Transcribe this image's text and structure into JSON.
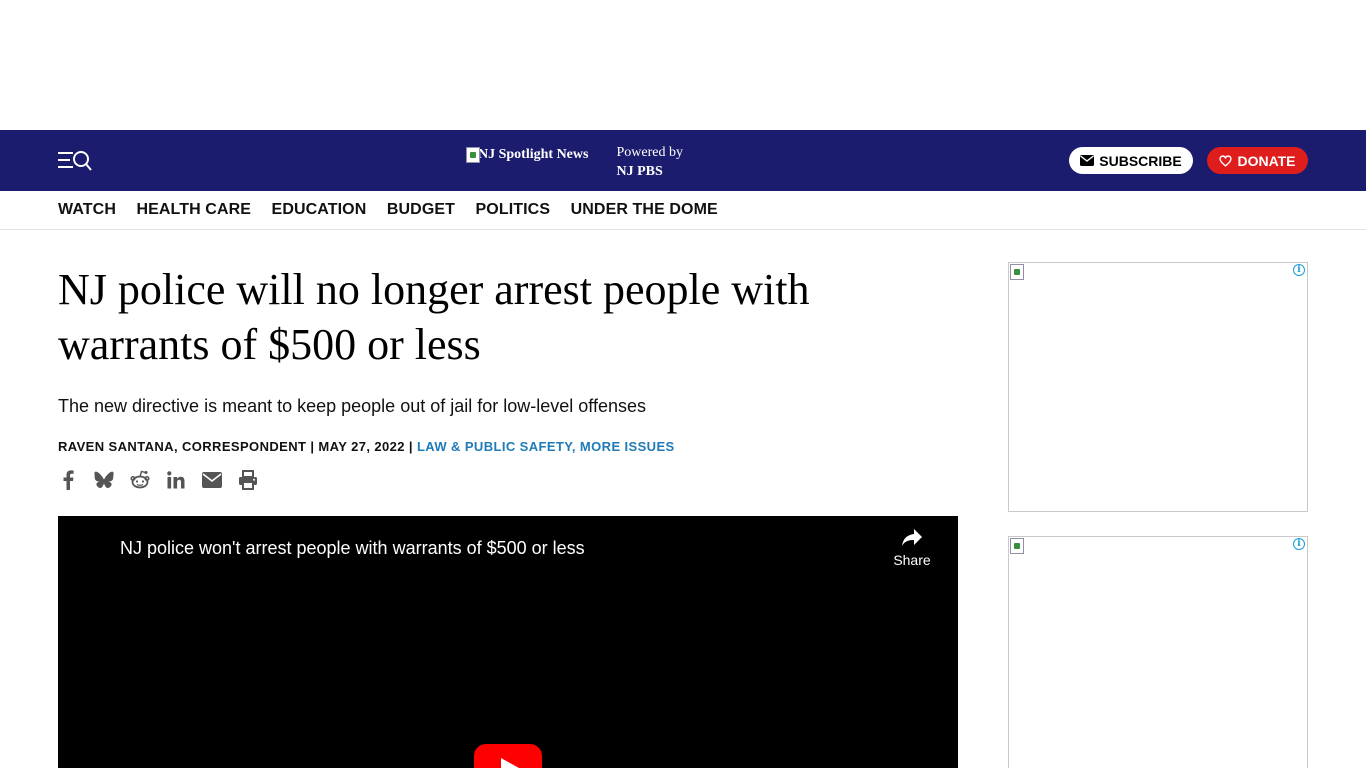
{
  "header": {
    "logo_alt": "NJ Spotlight News",
    "powered_by_label": "Powered by",
    "powered_by_name": "NJ PBS",
    "subscribe_label": "SUBSCRIBE",
    "donate_label": "DONATE",
    "menu_icon": "menu-search-icon"
  },
  "nav": {
    "items": [
      "WATCH",
      "HEALTH CARE",
      "EDUCATION",
      "BUDGET",
      "POLITICS",
      "UNDER THE DOME"
    ]
  },
  "article": {
    "headline": "NJ police will no longer arrest people with warrants of $500 or less",
    "subhead": "The new directive is meant to keep people out of jail for low-level offenses",
    "author": "RAVEN SANTANA, CORRESPONDENT",
    "date": "MAY 27, 2022",
    "category": "LAW & PUBLIC SAFETY, MORE ISSUES",
    "separator": " | ",
    "share_icons": [
      "facebook-icon",
      "bluesky-icon",
      "reddit-icon",
      "linkedin-icon",
      "email-icon",
      "print-icon"
    ]
  },
  "video": {
    "title": "NJ police won't arrest people with warrants of $500 or less",
    "share_label": "Share"
  },
  "ads": {
    "adchoices_glyph": "i"
  },
  "colors": {
    "header_bg": "#1b1c6e",
    "donate_bg": "#e01d1d",
    "link_blue": "#1f7ab8",
    "youtube_red": "#ff0000"
  }
}
